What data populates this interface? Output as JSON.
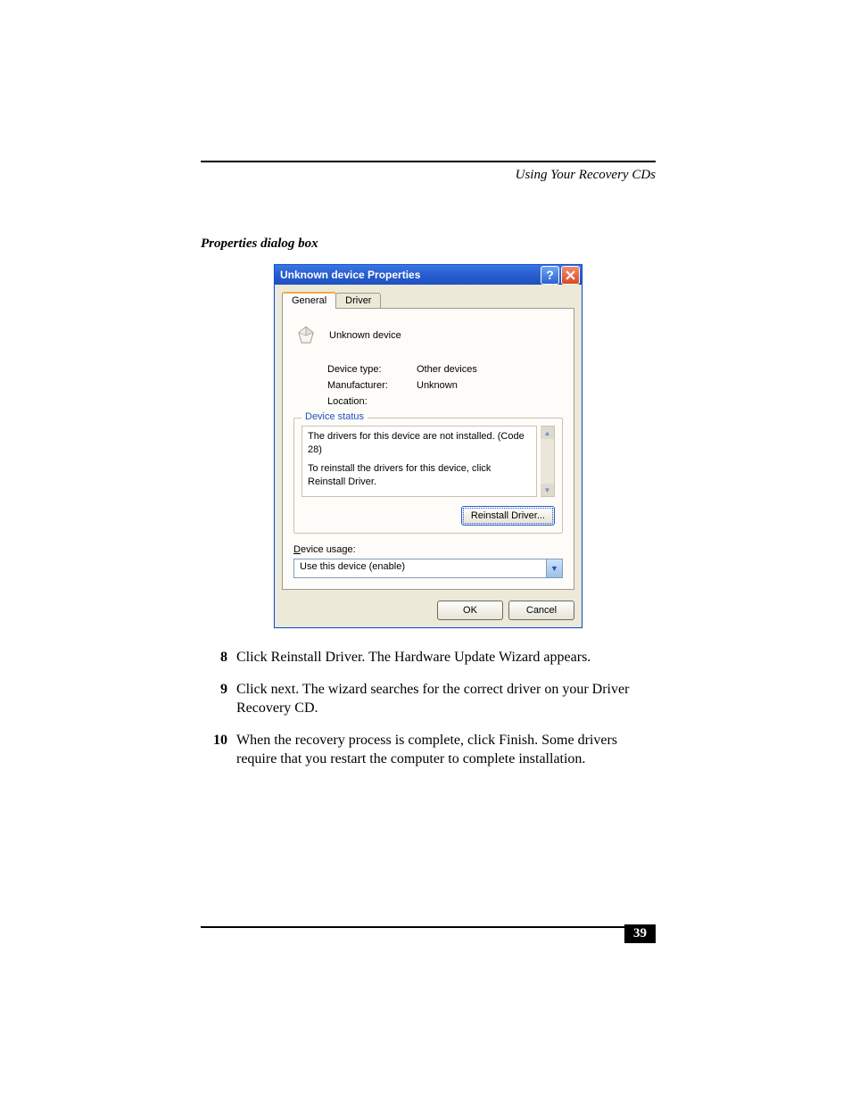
{
  "header": {
    "section_title": "Using Your Recovery CDs"
  },
  "caption": "Properties dialog box",
  "dialog": {
    "title": "Unknown device Properties",
    "tabs": [
      "General",
      "Driver"
    ],
    "active_tab": 0,
    "device_name": "Unknown device",
    "info": {
      "device_type_label": "Device type:",
      "device_type_value": "Other devices",
      "manufacturer_label": "Manufacturer:",
      "manufacturer_value": "Unknown",
      "location_label": "Location:",
      "location_value": ""
    },
    "status_legend": "Device status",
    "status_line1": "The drivers for this device are not installed. (Code 28)",
    "status_line2": "To reinstall the drivers for this device, click Reinstall Driver.",
    "reinstall_btn": "Reinstall Driver...",
    "usage_label_prefix": "D",
    "usage_label_rest": "evice usage:",
    "usage_value": "Use this device (enable)",
    "ok_btn": "OK",
    "cancel_btn": "Cancel"
  },
  "steps": [
    {
      "num": "8",
      "text": "Click Reinstall Driver. The Hardware Update Wizard appears."
    },
    {
      "num": "9",
      "text": "Click next. The wizard searches for the correct driver on your Driver Recovery CD."
    },
    {
      "num": "10",
      "text": "When the recovery process is complete, click Finish. Some drivers require that you restart the computer to complete installation."
    }
  ],
  "page_number": "39"
}
